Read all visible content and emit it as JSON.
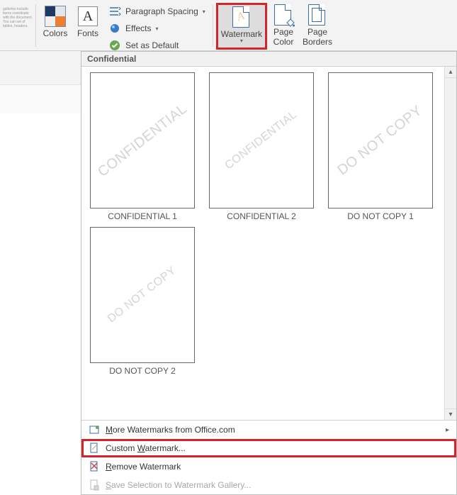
{
  "ribbon": {
    "colors_label": "Colors",
    "fonts_label": "Fonts",
    "paragraph_spacing_label": "Paragraph Spacing",
    "effects_label": "Effects",
    "set_default_label": "Set as Default",
    "watermark_label": "Watermark",
    "page_color_label": "Page\nColor",
    "page_borders_label": "Page\nBorders"
  },
  "dropdown": {
    "category_label": "Confidential",
    "thumbnails": [
      {
        "watermark_text": "CONFIDENTIAL",
        "caption": "CONFIDENTIAL 1",
        "size": "big"
      },
      {
        "watermark_text": "CONFIDENTIAL",
        "caption": "CONFIDENTIAL 2",
        "size": "small"
      },
      {
        "watermark_text": "DO NOT COPY",
        "caption": "DO NOT COPY 1",
        "size": "big"
      },
      {
        "watermark_text": "DO NOT COPY",
        "caption": "DO NOT COPY 2",
        "size": "small"
      }
    ],
    "menu": {
      "more_label": "More Watermarks from Office.com",
      "custom_label": "Custom Watermark...",
      "remove_label": "Remove Watermark",
      "save_label": "Save Selection to Watermark Gallery..."
    }
  }
}
